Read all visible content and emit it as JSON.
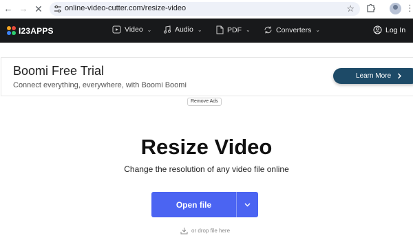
{
  "browser": {
    "url": "online-video-cutter.com/resize-video"
  },
  "header": {
    "logo_text": "I23APPS",
    "nav": [
      {
        "label": "Video",
        "icon": "video-icon"
      },
      {
        "label": "Audio",
        "icon": "music-note-icon"
      },
      {
        "label": "PDF",
        "icon": "document-icon"
      },
      {
        "label": "Converters",
        "icon": "convert-icon"
      }
    ],
    "login_label": "Log In"
  },
  "ad": {
    "title": "Boomi Free Trial",
    "subtitle": "Connect everything, everywhere, with Boomi Boomi",
    "cta_label": "Learn More",
    "remove_ads_label": "Remove Ads"
  },
  "main": {
    "title": "Resize Video",
    "subtitle": "Change the resolution of any video file online",
    "open_file_label": "Open file",
    "drop_hint": "or drop file here"
  },
  "colors": {
    "header_bg": "#18191b",
    "primary_button": "#4b64f2",
    "ad_button": "#1d4a67",
    "logo_dots": [
      "#f5a623",
      "#e84b3c",
      "#3b82f6",
      "#2ecc71"
    ]
  }
}
